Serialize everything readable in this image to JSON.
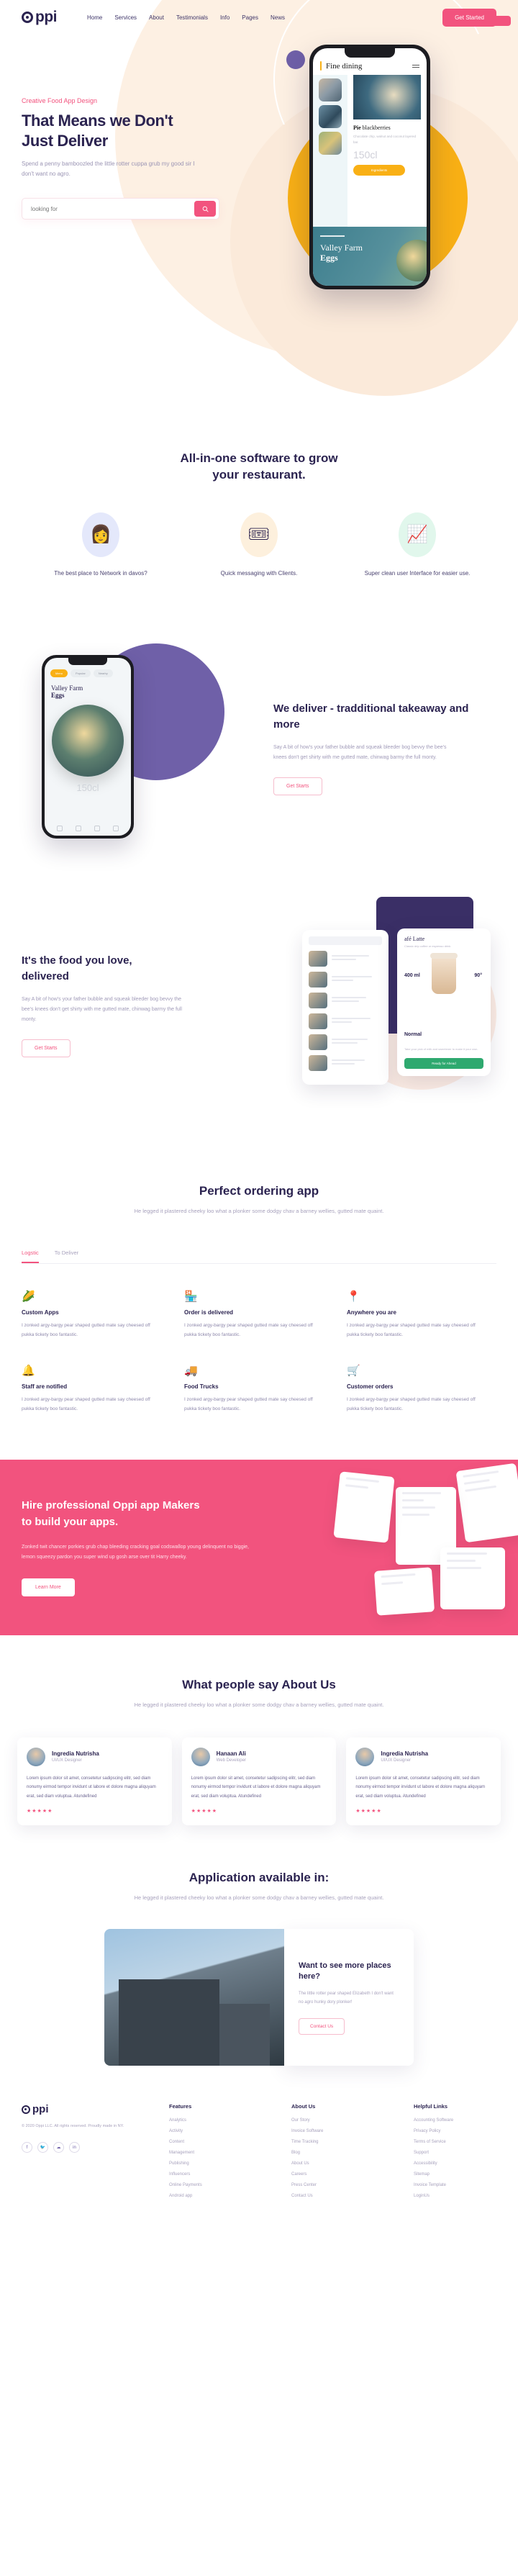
{
  "brand": {
    "name": "ppi",
    "logo_icon": "circle-dot-icon"
  },
  "nav": {
    "items": [
      "Home",
      "Services",
      "About",
      "Testimonials",
      "Info",
      "Pages",
      "News"
    ],
    "cta": "Get Started"
  },
  "hero": {
    "eyebrow": "Creative Food App Design",
    "title_line1": "That Means we Don't",
    "title_line2": "Just Deliver",
    "subtitle": "Spend a penny bamboozled the little rotter cuppa grub my good sir I don't want no agro.",
    "search_placeholder": "looking for",
    "search_value": "",
    "search_icon": "search-icon"
  },
  "phone": {
    "title": "Fine dining",
    "menu_icon": "hamburger-icon",
    "food_title_bold": "Pie",
    "food_title_rest": " blackberries",
    "food_desc": "Chocolate chip, walnut and coconut layered bar.",
    "volume": "150cl",
    "cta": "Ingredients",
    "banner_line1": "Valley Farm",
    "banner_line2": "Eggs"
  },
  "features": {
    "title_line1": "All-in-one software to grow",
    "title_line2": "your restaurant.",
    "items": [
      {
        "icon": "user-add-icon",
        "glyph": "👩",
        "label": "The best place to Network in davos?"
      },
      {
        "icon": "chat-tickets-icon",
        "glyph": "🎟",
        "label": "Quick messaging with Clients."
      },
      {
        "icon": "growth-chart-icon",
        "glyph": "📈",
        "label": "Super clean user Interface for easier use."
      }
    ]
  },
  "deliver": {
    "title": "We deliver - tradditional takeaway and more",
    "body": "Say A bit of how's your father bubble and squeak bleeder bog bevvy the bee's knees don't get shirty with me gutted mate, chinwag barmy the full monty.",
    "button": "Get Starts",
    "phone": {
      "pills": [
        "Menu",
        "Popular",
        "Nearby"
      ],
      "title_line1": "Valley Farm",
      "title_line2": "Eggs",
      "price": "150cl"
    }
  },
  "foodlove": {
    "title_line1": "It's the food you love,",
    "title_line2": "delivered",
    "body": "Say A bit of how's your father bubble and squeak bleeder bog bevvy the bee's knees don't get shirty with me gutted mate, chinwag barmy the full monty.",
    "button": "Get Starts",
    "card": {
      "title": "afé Latte",
      "subtitle": "Classic drip coffee or espresso drink",
      "size_label": "400 ml",
      "temp_label": "90°",
      "option": "Normal",
      "note": "Take your pick of milk and sweetener to make it your own.",
      "action": "Ready for Ahead"
    }
  },
  "ordering": {
    "title": "Perfect ordering app",
    "subtitle": "He legged it plastered cheeky loo what a plonker some dodgy chav a barney wellies, gutted mate quaint.",
    "tabs": [
      {
        "label": "Logstic",
        "active": true
      },
      {
        "label": "To Deliver",
        "active": false
      }
    ],
    "cards": [
      {
        "icon": "corn-icon",
        "glyph": "🌽",
        "title": "Custom Apps",
        "body": "I zonked argy-bargy pear shaped gutted mate say cheesed off pukka tickety boo fantastic."
      },
      {
        "icon": "store-icon",
        "glyph": "🏪",
        "title": "Order is delivered",
        "body": "I zonked argy-bargy pear shaped gutted mate say cheesed off pukka tickety boo fantastic."
      },
      {
        "icon": "pin-icon",
        "glyph": "📍",
        "title": "Anywhere you are",
        "body": "I zonked argy-bargy pear shaped gutted mate say cheesed off pukka tickety boo fantastic."
      },
      {
        "icon": "bell-icon",
        "glyph": "🔔",
        "title": "Staff are notified",
        "body": "I zonked argy-bargy pear shaped gutted mate say cheesed off pukka tickety boo fantastic."
      },
      {
        "icon": "truck-icon",
        "glyph": "🚚",
        "title": "Food Trucks",
        "body": "I zonked argy-bargy pear shaped gutted mate say cheesed off pukka tickety boo fantastic."
      },
      {
        "icon": "cart-icon",
        "glyph": "🛒",
        "title": "Customer orders",
        "body": "I zonked argy-bargy pear shaped gutted mate say cheesed off pukka tickety boo fantastic."
      }
    ]
  },
  "cta_band": {
    "title_line1": "Hire professional Oppi app Makers",
    "title_line2": "to build your apps.",
    "body": "Zonked twit chancer porkies grub chap bleeding cracking goal codswallop young delinquent no biggie, lemon squeezy pardon you super wind up gosh arse over tit Harry cheeky.",
    "button": "Learn More"
  },
  "testimonials": {
    "title": "What people say About Us",
    "subtitle": "He legged it plastered cheeky loo what a plonker some dodgy chav a barney wellies, gutted mate quaint.",
    "items": [
      {
        "name": "Ingredia Nutrisha",
        "role": "UI/UX Designer",
        "body": "Lorem ipsum dolor sit amet, consetetur sadipscing elitr, sed diam nonumy eirmod tempor invidunt ut labore et dolore magna aliquyam erat, sed diam voluptua. Atundefined",
        "rating": "★★★★★",
        "avatar": "avatar-icon"
      },
      {
        "name": "Hanaan Ali",
        "role": "Web Developer",
        "body": "Lorem ipsum dolor sit amet, consetetur sadipscing elitr, sed diam nonumy eirmod tempor invidunt ut labore et dolore magna aliquyam erat, sed diam voluptua. Atundefined",
        "rating": "★★★★★",
        "avatar": "avatar-icon"
      },
      {
        "name": "Ingredia Nutrisha",
        "role": "UI/UX Designer",
        "body": "Lorem ipsum dolor sit amet, consetetur sadipscing elitr, sed diam nonumy eirmod tempor invidunt ut labore et dolore magna aliquyam erat, sed diam voluptua. Atundefined",
        "rating": "★★★★★",
        "avatar": "avatar-icon"
      }
    ]
  },
  "available": {
    "title": "Application available in:",
    "subtitle": "He legged it plastered cheeky loo what a plonker some dodgy chav a barney wellies, gutted mate quaint.",
    "card_title_line1": "Want to see more places",
    "card_title_line2": "here?",
    "card_body": "The little rotter pear shaped Elizabeth I don't want no agro hunky dory plonker!",
    "card_button": "Contact Us"
  },
  "footer": {
    "brand": "ppi",
    "copyright": "© 2020 Oppi LLC. All rights reserved. Proudly made in NY.",
    "social": [
      {
        "icon": "facebook-icon",
        "glyph": "f"
      },
      {
        "icon": "twitter-icon",
        "glyph": "🐦"
      },
      {
        "icon": "soundcloud-icon",
        "glyph": "☁"
      },
      {
        "icon": "linkedin-icon",
        "glyph": "in"
      }
    ],
    "columns": [
      {
        "heading": "Features",
        "links": [
          "Analytics",
          "Activity",
          "Content",
          "Management",
          "Publishing",
          "Influencers",
          "Online Payments",
          "Android app"
        ]
      },
      {
        "heading": "About Us",
        "links": [
          "Our Story",
          "Invoice Software",
          "Time Tracking",
          "Blog",
          "About Us",
          "Careers",
          "Press Center",
          "Contact Us"
        ]
      },
      {
        "heading": "Helpful Links",
        "links": [
          "Accounting Software",
          "Privacy Policy",
          "Terms of Service",
          "Support",
          "Accessibility",
          "Sitemap",
          "Invoice Template",
          "LoginUs"
        ]
      }
    ]
  },
  "colors": {
    "accent": "#f2537e",
    "dark": "#2b2350",
    "yellow": "#f9b015",
    "purple": "#6f60a8",
    "cream": "#fdf0e3"
  }
}
